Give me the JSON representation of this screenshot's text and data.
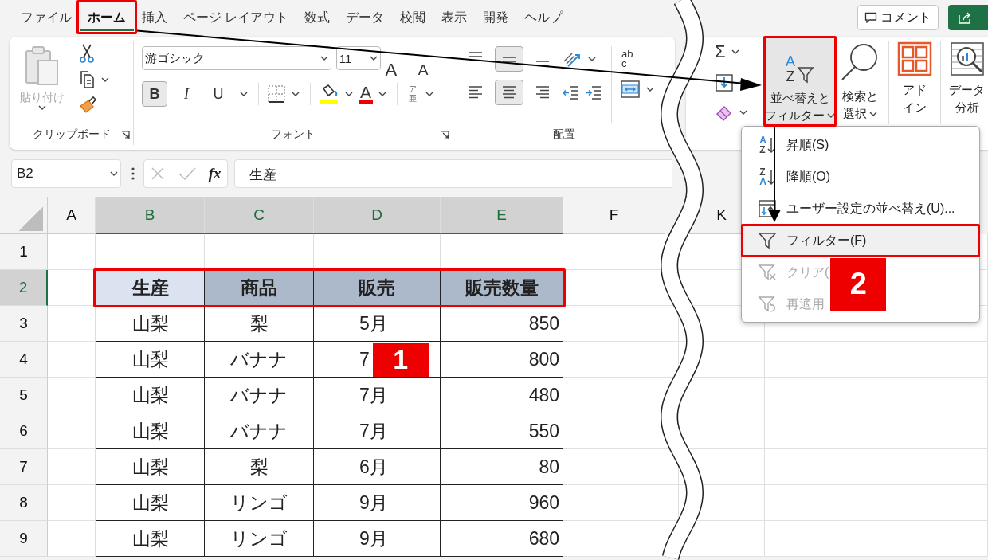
{
  "ribbon_tabs": [
    {
      "label": "ファイル",
      "selected": false
    },
    {
      "label": "ホーム",
      "selected": true
    },
    {
      "label": "挿入",
      "selected": false
    },
    {
      "label": "ページ レイアウト",
      "selected": false
    },
    {
      "label": "数式",
      "selected": false
    },
    {
      "label": "データ",
      "selected": false
    },
    {
      "label": "校閲",
      "selected": false
    },
    {
      "label": "表示",
      "selected": false
    },
    {
      "label": "開発",
      "selected": false
    },
    {
      "label": "ヘルプ",
      "selected": false
    }
  ],
  "comment_button": {
    "label": "コメント"
  },
  "clipboard": {
    "paste_label": "貼り付け",
    "paste_disabled": true,
    "group_label": "クリップボード"
  },
  "font": {
    "name": "游ゴシック",
    "size": "11",
    "grow_label": "A",
    "shrink_label": "A",
    "styles": [
      {
        "label": "B",
        "pressed": true
      },
      {
        "label": "I",
        "pressed": false
      },
      {
        "label": "U",
        "pressed": false
      }
    ],
    "color_label": "A",
    "phonetic": [
      "ア",
      "亜"
    ],
    "group_label": "フォント"
  },
  "alignment": {
    "vertical": [
      {
        "kind": "top",
        "pressed": false
      },
      {
        "kind": "middle",
        "pressed": true
      },
      {
        "kind": "bottom",
        "pressed": false
      }
    ],
    "horizontal": [
      {
        "kind": "left",
        "pressed": false
      },
      {
        "kind": "center",
        "pressed": true
      },
      {
        "kind": "right",
        "pressed": false
      }
    ],
    "wrap_glyph": [
      "ab",
      "c"
    ],
    "group_label": "配置"
  },
  "editing": {
    "autosum": "Σ"
  },
  "sort_filter": {
    "icon_letters": [
      "A",
      "Z"
    ],
    "label_lines": [
      "並べ替えと",
      "フィルター"
    ]
  },
  "find_select": {
    "label_lines": [
      "検索と",
      "選択"
    ]
  },
  "addins": {
    "label_lines": [
      "アド",
      "イン"
    ]
  },
  "data_analysis": {
    "label_lines": [
      "データ",
      "分析"
    ]
  },
  "formula_bar": {
    "name_box": "B2",
    "function_label": "fx",
    "value": "生産"
  },
  "sheet": {
    "columns": [
      {
        "letter": "A",
        "selected": false
      },
      {
        "letter": "B",
        "selected": true
      },
      {
        "letter": "C",
        "selected": true
      },
      {
        "letter": "D",
        "selected": true
      },
      {
        "letter": "E",
        "selected": true
      },
      {
        "letter": "F",
        "selected": false
      }
    ],
    "right_columns": [
      {
        "letter": "K",
        "selected": false
      }
    ],
    "rows": [
      {
        "header": "1",
        "selected": false,
        "kind": "blank"
      },
      {
        "header": "2",
        "selected": true,
        "kind": "heading",
        "cells": [
          {
            "text": "生産",
            "active": true
          },
          {
            "text": "商品",
            "active": false
          },
          {
            "text": "販売",
            "active": false
          },
          {
            "text": "販売数量",
            "active": false
          }
        ]
      },
      {
        "header": "3",
        "selected": false,
        "kind": "data",
        "cells": [
          "山梨",
          "梨",
          "5月",
          "850"
        ]
      },
      {
        "header": "4",
        "selected": false,
        "kind": "data",
        "cells": [
          "山梨",
          "バナナ",
          "7",
          "800"
        ]
      },
      {
        "header": "5",
        "selected": false,
        "kind": "data",
        "cells": [
          "山梨",
          "バナナ",
          "7月",
          "480"
        ]
      },
      {
        "header": "6",
        "selected": false,
        "kind": "data",
        "cells": [
          "山梨",
          "バナナ",
          "7月",
          "550"
        ]
      },
      {
        "header": "7",
        "selected": false,
        "kind": "data",
        "cells": [
          "山梨",
          "梨",
          "6月",
          "80"
        ]
      },
      {
        "header": "8",
        "selected": false,
        "kind": "data",
        "cells": [
          "山梨",
          "リンゴ",
          "9月",
          "960"
        ]
      },
      {
        "header": "9",
        "selected": false,
        "kind": "data",
        "cells": [
          "山梨",
          "リンゴ",
          "9月",
          "680"
        ]
      }
    ]
  },
  "sort_menu": {
    "items": [
      {
        "kind": "asc",
        "label": "昇順(S)",
        "icon_letters": [
          "A",
          "Z"
        ],
        "highlighted": false,
        "disabled": false
      },
      {
        "kind": "desc",
        "label": "降順(O)",
        "icon_letters": [
          "Z",
          "A"
        ],
        "highlighted": false,
        "disabled": false
      },
      {
        "kind": "custom",
        "label": "ユーザー設定の並べ替え(U)...",
        "highlighted": false,
        "disabled": false
      },
      {
        "kind": "filter",
        "label": "フィルター(F)",
        "highlighted": true,
        "disabled": false
      },
      {
        "kind": "clear",
        "label": "クリア(",
        "highlighted": false,
        "disabled": true
      },
      {
        "kind": "reapply",
        "label": "再適用",
        "highlighted": false,
        "disabled": true
      }
    ]
  },
  "annotations": {
    "badges": [
      "1",
      "2"
    ]
  }
}
